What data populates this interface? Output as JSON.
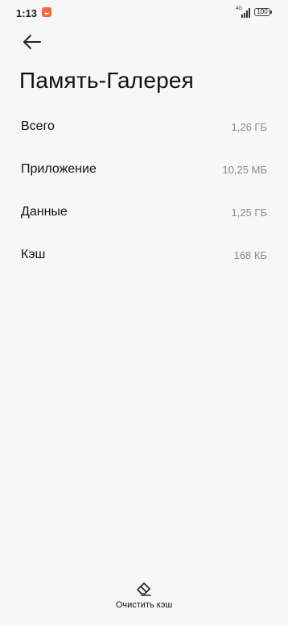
{
  "status_bar": {
    "time": "1:13",
    "network": "4G",
    "battery": "100",
    "icons": [
      "notification-icon",
      "signal-icon",
      "battery-icon"
    ]
  },
  "header": {
    "back_icon": "arrow-left-icon",
    "title": "Память-Галерея"
  },
  "storage": {
    "rows": [
      {
        "label": "Всего",
        "value": "1,26 ГБ"
      },
      {
        "label": "Приложение",
        "value": "10,25 МБ"
      },
      {
        "label": "Данные",
        "value": "1,25 ГБ"
      },
      {
        "label": "Кэш",
        "value": "168 КБ"
      }
    ]
  },
  "actions": {
    "clear_cache_icon": "eraser-icon",
    "clear_cache_label": "Очистить кэш"
  },
  "colors": {
    "background": "#f7f7f7",
    "secondary_text": "#8a8a8a",
    "notification_accent": "#f2693b"
  }
}
